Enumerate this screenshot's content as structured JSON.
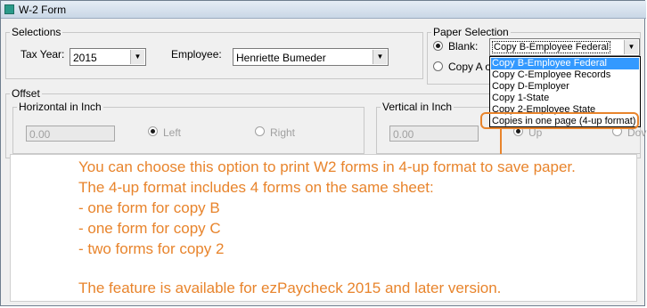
{
  "window": {
    "title": "W-2 Form"
  },
  "selections": {
    "legend": "Selections",
    "tax_year_label": "Tax Year:",
    "tax_year_value": "2015",
    "employee_label": "Employee:",
    "employee_value": "Henriette Bumeder"
  },
  "paper_selection": {
    "legend": "Paper Selection",
    "blank_label": "Blank:",
    "blank_value": "Copy B-Employee Federal",
    "copy_a_label": "Copy A o",
    "dropdown_items": [
      "Copy B-Employee Federal",
      "Copy C-Employee Records",
      "Copy D-Employer",
      "Copy 1-State",
      "Copy 2-Employee State",
      "Copies in one page (4-up format)"
    ]
  },
  "offset": {
    "legend": "Offset",
    "horizontal": {
      "legend": "Horizontal in Inch",
      "value": "0.00",
      "left_label": "Left",
      "right_label": "Right"
    },
    "vertical": {
      "legend": "Vertical in Inch",
      "value": "0.00",
      "up_label": "Up",
      "down_label": "Dov"
    }
  },
  "callout": {
    "lines": [
      "You can choose this option to print W2 forms in 4-up format to save paper.",
      "The 4-up format includes 4 forms on the same sheet:",
      "- one form for copy B",
      "- one form for copy C",
      "- two forms for copy 2",
      "The feature is available for ezPaycheck 2015 and later version."
    ]
  },
  "colors": {
    "accent": "#e8842c",
    "selection": "#3399ff"
  }
}
